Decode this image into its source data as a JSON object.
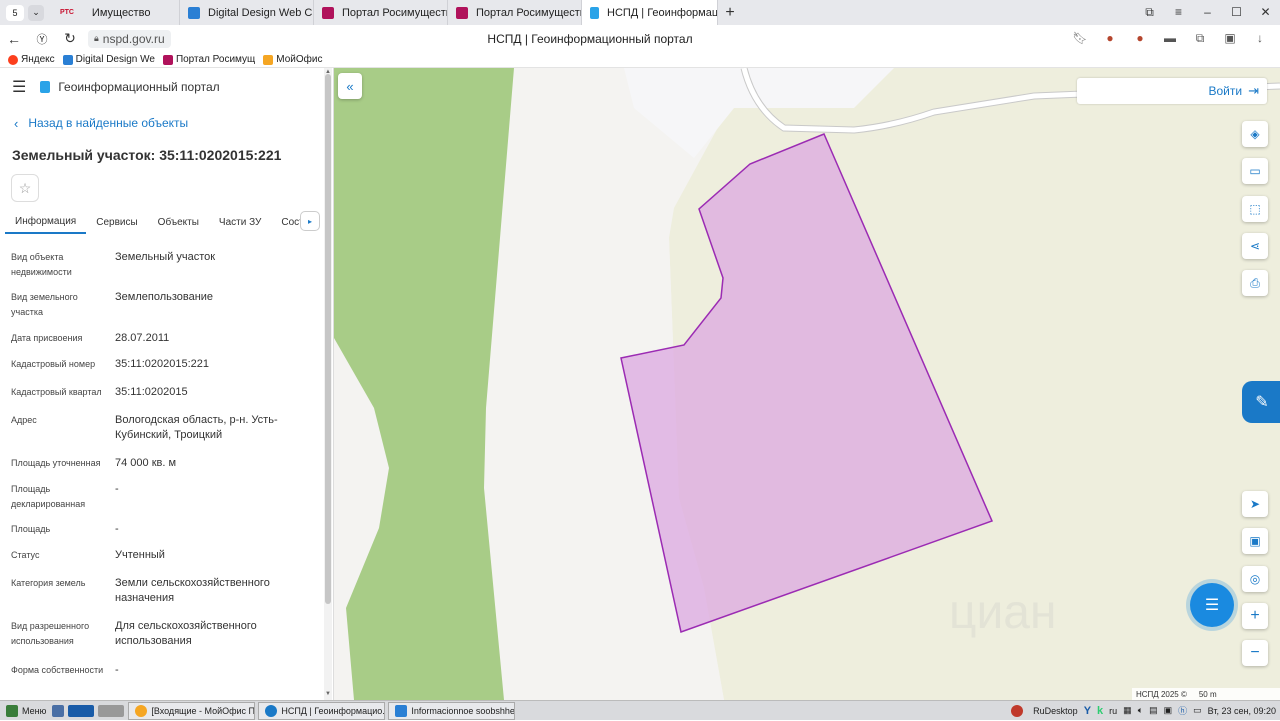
{
  "browser": {
    "tab_count": "5",
    "tabs": [
      {
        "label": "Имущество",
        "color": "#c8102e",
        "fav_text": "РТС"
      },
      {
        "label": "Digital Design Web Client",
        "color": "#2a7fd4"
      },
      {
        "label": "Портал Росимущества",
        "color": "#b0125b"
      },
      {
        "label": "Портал Росимущества",
        "color": "#b0125b"
      },
      {
        "label": "НСПД | Геоинформац",
        "color": "#2aa3e8",
        "active": true
      }
    ],
    "url": "nspd.gov.ru",
    "page_title": "НСПД | Геоинформационный портал",
    "bookmarks": [
      {
        "label": "Яндекс",
        "color": "#fc3f1d"
      },
      {
        "label": "Digital Design We",
        "color": "#2a7fd4"
      },
      {
        "label": "Портал Росимущ",
        "color": "#b0125b"
      },
      {
        "label": "МойОфис",
        "color": "#f5a623"
      }
    ]
  },
  "sidebar": {
    "portal_name": "Геоинформационный портал",
    "back_link": "Назад в найденные объекты",
    "title": "Земельный участок: 35:11:0202015:221",
    "tabs": [
      "Информация",
      "Сервисы",
      "Объекты",
      "Части ЗУ",
      "Соста"
    ],
    "properties": [
      {
        "key": "Вид объекта недвижимости",
        "value": "Земельный участок"
      },
      {
        "key": "Вид земельного участка",
        "value": "Землепользование"
      },
      {
        "key": "Дата присвоения",
        "value": "28.07.2011"
      },
      {
        "key": "Кадастровый номер",
        "value": "35:11:0202015:221"
      },
      {
        "key": "Кадастровый квартал",
        "value": "35:11:0202015"
      },
      {
        "key": "Адрес",
        "value": "Вологодская область, р-н. Усть-Кубинский, Троицкий"
      },
      {
        "key": "Площадь уточненная",
        "value": "74 000 кв. м"
      },
      {
        "key": "Площадь декларированная",
        "value": "-"
      },
      {
        "key": "Площадь",
        "value": "-"
      },
      {
        "key": "Статус",
        "value": "Учтенный"
      },
      {
        "key": "Категория земель",
        "value": "Земли сельскохозяйственного назначения"
      },
      {
        "key": "Вид разрешенного использования",
        "value": "Для сельскохозяйственного использования"
      },
      {
        "key": "Форма собственности",
        "value": "-"
      }
    ]
  },
  "map": {
    "login_label": "Войти",
    "attribution": "НСПД 2025 ©",
    "scale_label": "50 m",
    "watermark": "циан",
    "colors": {
      "forest": "#a8cc87",
      "field": "#eeeedd",
      "parcel_fill": "#dca8e0",
      "parcel_stroke": "#9b2bb3"
    }
  },
  "taskbar": {
    "start_label": "Меню",
    "windows": [
      {
        "label": "[Входящие - МойОфис П...",
        "color": "#f5a623"
      },
      {
        "label": "НСПД | Геоинформацио...",
        "color": "#1a79c7"
      },
      {
        "label": "Informacionnoe soobshhe...",
        "color": "#2a7fd4"
      }
    ],
    "tray_app": "RuDesktop",
    "lang": "ru",
    "clock": "Вт, 23 сен, 09:20"
  }
}
